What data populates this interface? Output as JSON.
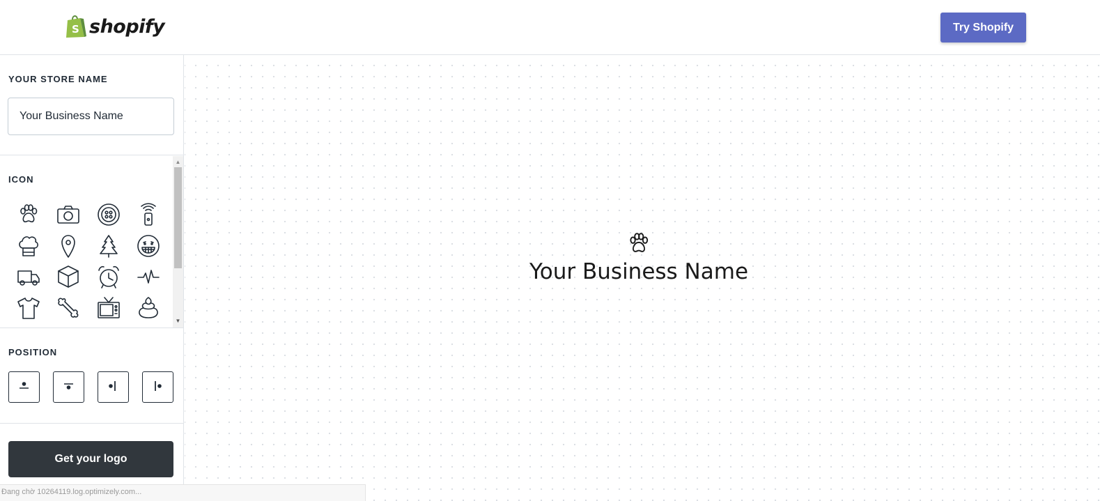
{
  "header": {
    "logo_text": "shopify",
    "try_button": "Try Shopify",
    "accent_color": "#5c6ac4"
  },
  "sidebar": {
    "store_name_title": "YOUR STORE NAME",
    "store_name_value": "Your Business Name",
    "icon_title": "ICON",
    "icons": [
      "paw-icon",
      "camera-icon",
      "button-icon",
      "remote-icon",
      "chef-hat-icon",
      "location-pin-icon",
      "pine-tree-icon",
      "grin-face-icon",
      "truck-icon",
      "box-icon",
      "alarm-clock-icon",
      "heartbeat-icon",
      "tshirt-icon",
      "bone-icon",
      "tv-icon",
      "poop-icon"
    ],
    "position_title": "POSITION",
    "positions": [
      "icon-above",
      "icon-top-center",
      "icon-left",
      "icon-right"
    ],
    "cta_label": "Get your logo"
  },
  "preview": {
    "business_name": "Your Business Name",
    "icon": "paw-icon"
  },
  "status_bar": "Đang chờ 10264119.log.optimizely.com..."
}
